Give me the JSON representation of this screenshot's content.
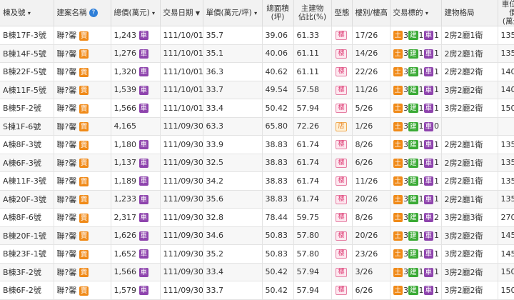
{
  "headers": {
    "unit": "棟及號",
    "project": "建案名稱",
    "help": "?",
    "total": "總價(萬元)",
    "date": "交易日期",
    "sort": "▼",
    "price": "單價(萬元/坪)",
    "area": "總面積\n(坪)",
    "ratio": "主建物\n佔比(%)",
    "type": "型態",
    "floor": "樓別/樓高",
    "deal": "交易標的",
    "layout": "建物格局",
    "parking": "車位總價\n(萬元)"
  },
  "badges": {
    "land": "土",
    "build": "建",
    "car": "車",
    "sell": "賣",
    "apt": "樓",
    "shop": "店",
    "price_note": "車"
  },
  "rows": [
    {
      "unit": "B棟17F-3號",
      "project": "聯?馨",
      "total": "1,243",
      "total_badge": true,
      "date": "111/10/01",
      "price": "35.7",
      "area": "39.06",
      "ratio": "61.33",
      "type": "樓",
      "floor": "17/26",
      "deal": [
        "3",
        "1",
        "1"
      ],
      "layout": "2房2廳1衛",
      "parking": "135"
    },
    {
      "unit": "B棟14F-5號",
      "project": "聯?馨",
      "total": "1,276",
      "total_badge": true,
      "date": "111/10/01",
      "price": "35.1",
      "area": "40.06",
      "ratio": "61.11",
      "type": "樓",
      "floor": "14/26",
      "deal": [
        "3",
        "1",
        "1"
      ],
      "layout": "2房2廳1衛",
      "parking": "135"
    },
    {
      "unit": "B棟22F-5號",
      "project": "聯?馨",
      "total": "1,320",
      "total_badge": true,
      "date": "111/10/01",
      "price": "36.3",
      "area": "40.62",
      "ratio": "61.11",
      "type": "樓",
      "floor": "22/26",
      "deal": [
        "3",
        "1",
        "1"
      ],
      "layout": "2房2廳2衛",
      "parking": "140"
    },
    {
      "unit": "A棟11F-5號",
      "project": "聯?馨",
      "total": "1,539",
      "total_badge": true,
      "date": "111/10/01",
      "price": "33.7",
      "area": "49.54",
      "ratio": "57.58",
      "type": "樓",
      "floor": "11/26",
      "deal": [
        "3",
        "1",
        "1"
      ],
      "layout": "3房2廳2衛",
      "parking": "140"
    },
    {
      "unit": "B棟5F-2號",
      "project": "聯?馨",
      "total": "1,566",
      "total_badge": true,
      "date": "111/10/01",
      "price": "33.4",
      "area": "50.42",
      "ratio": "57.94",
      "type": "樓",
      "floor": "5/26",
      "deal": [
        "3",
        "1",
        "1"
      ],
      "layout": "3房2廳2衛",
      "parking": "150"
    },
    {
      "unit": "S棟1F-6號",
      "project": "聯?馨",
      "total": "4,165",
      "total_badge": false,
      "date": "111/09/30",
      "price": "63.3",
      "area": "65.80",
      "ratio": "72.26",
      "type": "店",
      "floor": "1/26",
      "deal": [
        "3",
        "1",
        "0"
      ],
      "layout": "",
      "parking": ""
    },
    {
      "unit": "A棟8F-3號",
      "project": "聯?馨",
      "total": "1,180",
      "total_badge": true,
      "date": "111/09/30",
      "price": "33.9",
      "area": "38.83",
      "ratio": "61.74",
      "type": "樓",
      "floor": "8/26",
      "deal": [
        "3",
        "1",
        "1"
      ],
      "layout": "2房2廳1衛",
      "parking": "135"
    },
    {
      "unit": "A棟6F-3號",
      "project": "聯?馨",
      "total": "1,137",
      "total_badge": true,
      "date": "111/09/30",
      "price": "32.5",
      "area": "38.83",
      "ratio": "61.74",
      "type": "樓",
      "floor": "6/26",
      "deal": [
        "3",
        "1",
        "1"
      ],
      "layout": "2房2廳1衛",
      "parking": "135"
    },
    {
      "unit": "A棟11F-3號",
      "project": "聯?馨",
      "total": "1,189",
      "total_badge": true,
      "date": "111/09/30",
      "price": "34.2",
      "area": "38.83",
      "ratio": "61.74",
      "type": "樓",
      "floor": "11/26",
      "deal": [
        "3",
        "1",
        "1"
      ],
      "layout": "2房2廳1衛",
      "parking": "135"
    },
    {
      "unit": "A棟20F-3號",
      "project": "聯?馨",
      "total": "1,233",
      "total_badge": true,
      "date": "111/09/30",
      "price": "35.6",
      "area": "38.83",
      "ratio": "61.74",
      "type": "樓",
      "floor": "20/26",
      "deal": [
        "3",
        "1",
        "1"
      ],
      "layout": "2房2廳1衛",
      "parking": "135"
    },
    {
      "unit": "A棟8F-6號",
      "project": "聯?馨",
      "total": "2,317",
      "total_badge": true,
      "date": "111/09/30",
      "price": "32.8",
      "area": "78.44",
      "ratio": "59.75",
      "type": "樓",
      "floor": "8/26",
      "deal": [
        "3",
        "1",
        "2"
      ],
      "layout": "3房2廳3衛",
      "parking": "270"
    },
    {
      "unit": "B棟20F-1號",
      "project": "聯?馨",
      "total": "1,626",
      "total_badge": true,
      "date": "111/09/30",
      "price": "34.6",
      "area": "50.83",
      "ratio": "57.80",
      "type": "樓",
      "floor": "20/26",
      "deal": [
        "3",
        "1",
        "1"
      ],
      "layout": "3房2廳2衛",
      "parking": "145"
    },
    {
      "unit": "B棟23F-1號",
      "project": "聯?馨",
      "total": "1,652",
      "total_badge": true,
      "date": "111/09/30",
      "price": "35.2",
      "area": "50.83",
      "ratio": "57.80",
      "type": "樓",
      "floor": "23/26",
      "deal": [
        "3",
        "1",
        "1"
      ],
      "layout": "3房2廳2衛",
      "parking": "145"
    },
    {
      "unit": "B棟3F-2號",
      "project": "聯?馨",
      "total": "1,566",
      "total_badge": true,
      "date": "111/09/30",
      "price": "33.4",
      "area": "50.42",
      "ratio": "57.94",
      "type": "樓",
      "floor": "3/26",
      "deal": [
        "3",
        "1",
        "1"
      ],
      "layout": "3房2廳2衛",
      "parking": "150"
    },
    {
      "unit": "B棟6F-2號",
      "project": "聯?馨",
      "total": "1,579",
      "total_badge": true,
      "date": "111/09/30",
      "price": "33.7",
      "area": "50.42",
      "ratio": "57.94",
      "type": "樓",
      "floor": "6/26",
      "deal": [
        "3",
        "1",
        "1"
      ],
      "layout": "3房2廳2衛",
      "parking": "150"
    }
  ]
}
